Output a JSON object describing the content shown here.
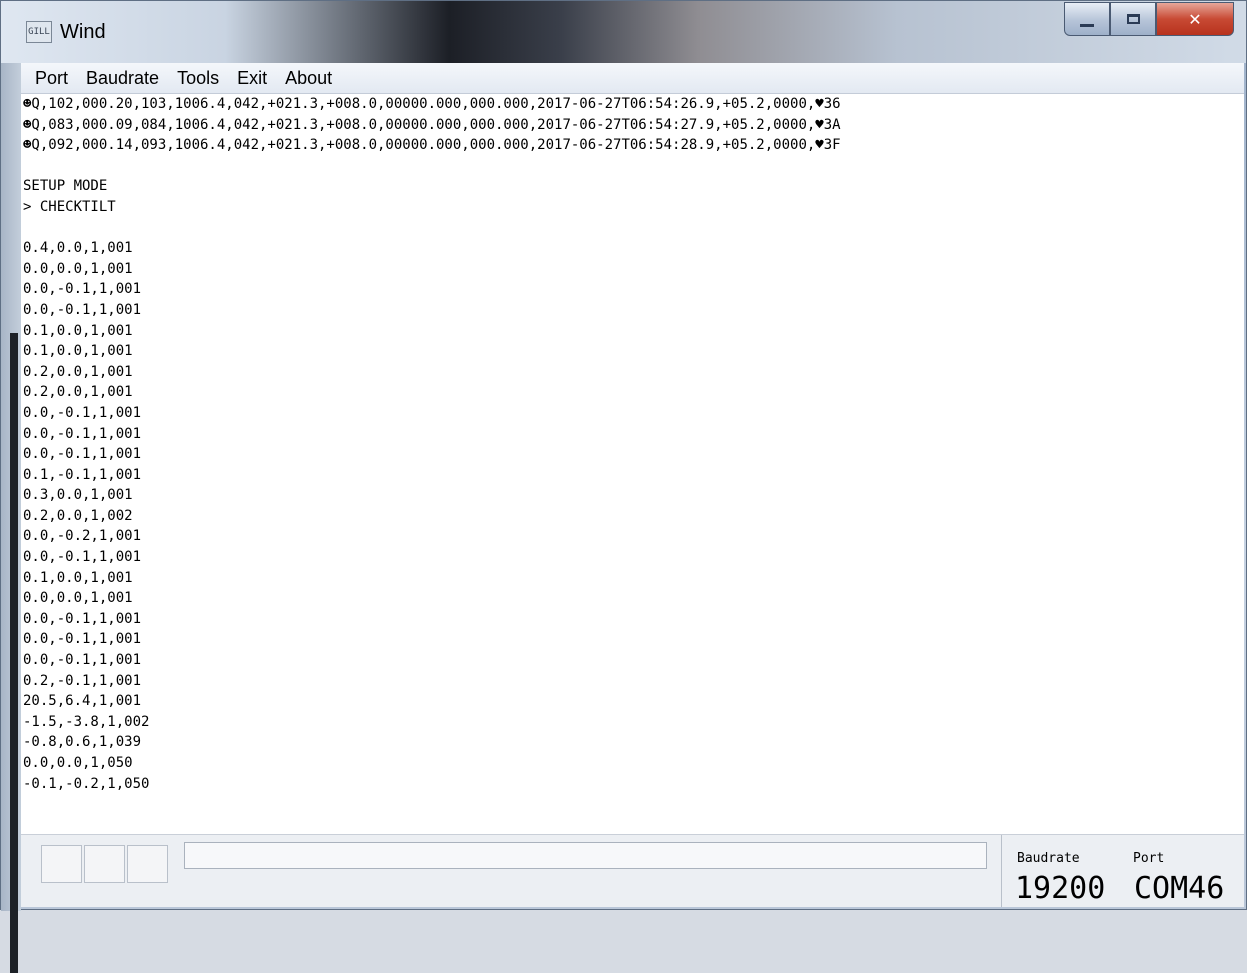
{
  "window": {
    "title": "Wind",
    "icon_text": "GILL"
  },
  "menu": {
    "items": [
      "Port",
      "Baudrate",
      "Tools",
      "Exit",
      "About"
    ]
  },
  "terminal": {
    "lines": [
      "☻Q,102,000.20,103,1006.4,042,+021.3,+008.0,00000.000,000.000,2017-06-27T06:54:26.9,+05.2,0000,♥36",
      "☻Q,083,000.09,084,1006.4,042,+021.3,+008.0,00000.000,000.000,2017-06-27T06:54:27.9,+05.2,0000,♥3A",
      "☻Q,092,000.14,093,1006.4,042,+021.3,+008.0,00000.000,000.000,2017-06-27T06:54:28.9,+05.2,0000,♥3F",
      "",
      "SETUP MODE",
      "> CHECKTILT",
      "",
      "0.4,0.0,1,001",
      "0.0,0.0,1,001",
      "0.0,-0.1,1,001",
      "0.0,-0.1,1,001",
      "0.1,0.0,1,001",
      "0.1,0.0,1,001",
      "0.2,0.0,1,001",
      "0.2,0.0,1,001",
      "0.0,-0.1,1,001",
      "0.0,-0.1,1,001",
      "0.0,-0.1,1,001",
      "0.1,-0.1,1,001",
      "0.3,0.0,1,001",
      "0.2,0.0,1,002",
      "0.0,-0.2,1,001",
      "0.0,-0.1,1,001",
      "0.1,0.0,1,001",
      "0.0,0.0,1,001",
      "0.0,-0.1,1,001",
      "0.0,-0.1,1,001",
      "0.0,-0.1,1,001",
      "0.2,-0.1,1,001",
      "20.5,6.4,1,001",
      "-1.5,-3.8,1,002",
      "-0.8,0.6,1,039",
      "0.0,0.0,1,050",
      "-0.1,-0.2,1,050"
    ]
  },
  "status": {
    "progress_fraction": 0.0,
    "baudrate_label": "Baudrate",
    "port_label": "Port",
    "baudrate_value": "19200",
    "port_value": "COM46"
  }
}
